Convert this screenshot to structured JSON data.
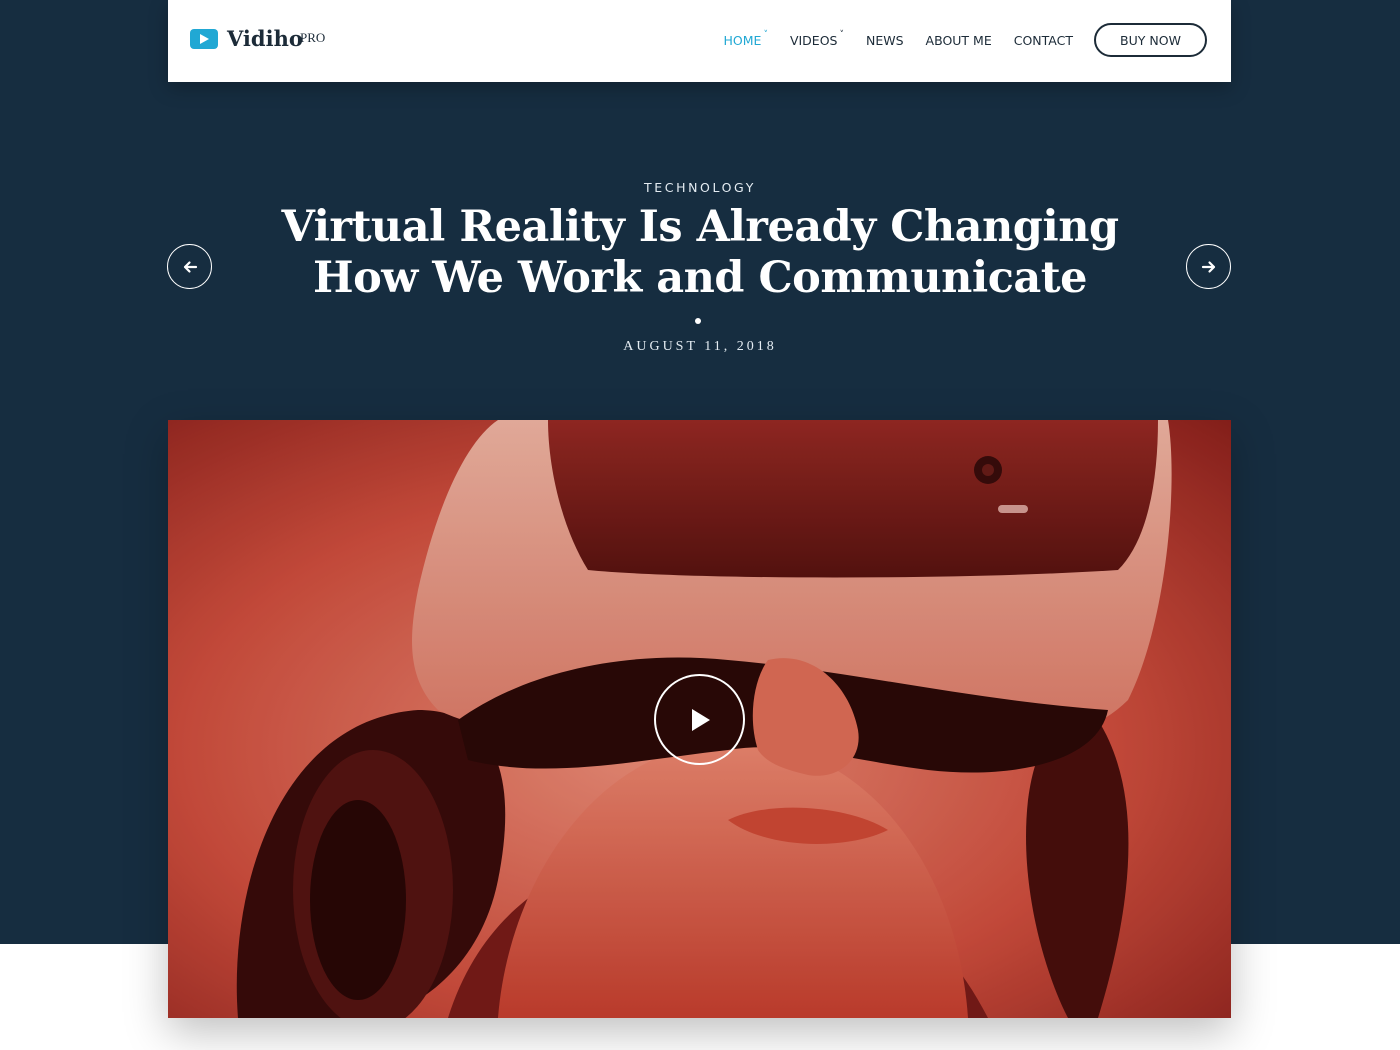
{
  "brand": {
    "name": "Vidiho",
    "badge": "PRO",
    "accent_color": "#21a8d4",
    "icon": "play-icon"
  },
  "nav": {
    "items": [
      {
        "label": "HOME",
        "has_dropdown": true,
        "active": true
      },
      {
        "label": "VIDEOS",
        "has_dropdown": true,
        "active": false
      },
      {
        "label": "NEWS",
        "has_dropdown": false,
        "active": false
      },
      {
        "label": "ABOUT ME",
        "has_dropdown": false,
        "active": false
      },
      {
        "label": "CONTACT",
        "has_dropdown": false,
        "active": false
      }
    ],
    "caret": "˅",
    "cta_label": "BUY NOW"
  },
  "hero": {
    "background_color": "#162d40",
    "category": "TECHNOLOGY",
    "title": "Virtual Reality Is Already Changing How We Work and Communicate",
    "date": "AUGUST 11, 2018",
    "prev_icon": "arrow-left-icon",
    "next_icon": "arrow-right-icon"
  },
  "media": {
    "description_icon": "play-icon",
    "tint_color": "#c93a2c"
  }
}
